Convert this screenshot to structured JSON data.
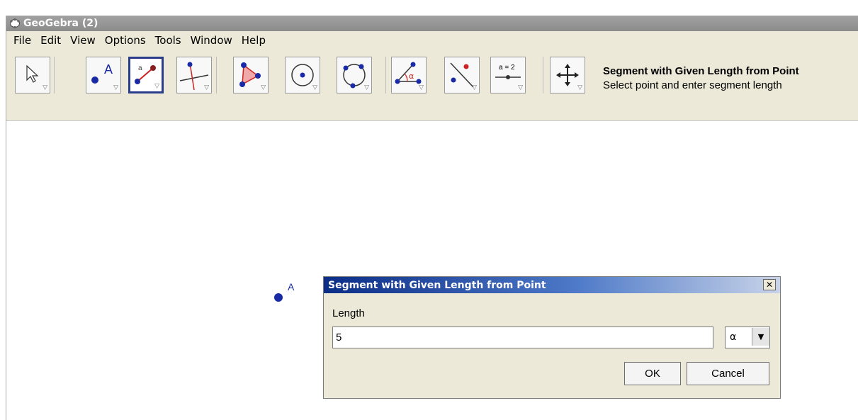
{
  "window": {
    "title": "GeoGebra (2)"
  },
  "menu": [
    "File",
    "Edit",
    "View",
    "Options",
    "Tools",
    "Window",
    "Help"
  ],
  "toolbar": {
    "tools": [
      {
        "name": "move-tool",
        "icon": "arrow-cursor-icon"
      },
      {
        "name": "point-tool",
        "icon": "point-icon"
      },
      {
        "name": "segment-length-tool",
        "icon": "segment-icon",
        "selected": true
      },
      {
        "name": "perpendicular-line-tool",
        "icon": "perpendicular-icon"
      },
      {
        "name": "polygon-tool",
        "icon": "polygon-icon"
      },
      {
        "name": "circle-center-tool",
        "icon": "circle-center-icon"
      },
      {
        "name": "circle-three-points-tool",
        "icon": "circle-three-points-icon"
      },
      {
        "name": "angle-tool",
        "icon": "angle-icon"
      },
      {
        "name": "reflect-tool",
        "icon": "reflect-icon"
      },
      {
        "name": "slider-tool",
        "icon": "slider-icon",
        "label": "a = 2"
      },
      {
        "name": "move-view-tool",
        "icon": "move-graphics-view-icon"
      }
    ],
    "active_tool_name": "Segment with Given Length from Point",
    "active_tool_help": "Select point and enter segment length"
  },
  "canvas": {
    "point_label": "A"
  },
  "dialog": {
    "title": "Segment with Given Length from Point",
    "close_label": "✕",
    "field_label": "Length",
    "field_value": "5",
    "symbol_value": "α",
    "ok_label": "OK",
    "cancel_label": "Cancel"
  },
  "colors": {
    "point": "#1a2aa6",
    "selected_tool_border": "#2a3c8c",
    "dialog_title_start": "#0b2d86",
    "menu_background": "#ece9d8"
  }
}
